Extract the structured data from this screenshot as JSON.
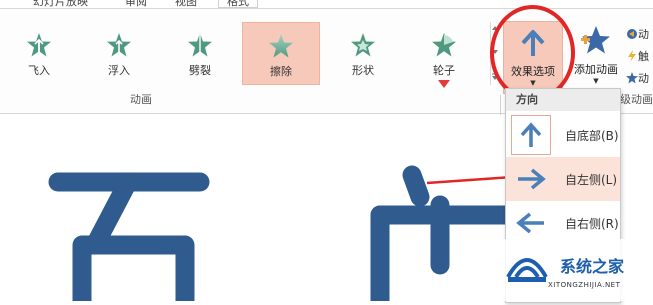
{
  "tabs": [
    {
      "label": "幻灯片放映"
    },
    {
      "label": "审阅"
    },
    {
      "label": "视图"
    },
    {
      "label": "格式"
    }
  ],
  "animations": [
    {
      "label": "飞入",
      "icon": "star-fly-in-icon"
    },
    {
      "label": "浮入",
      "icon": "star-float-in-icon"
    },
    {
      "label": "劈裂",
      "icon": "star-split-icon"
    },
    {
      "label": "擦除",
      "icon": "star-wipe-icon",
      "selected": true
    },
    {
      "label": "形状",
      "icon": "star-shape-icon"
    },
    {
      "label": "轮子",
      "icon": "star-wheel-icon"
    }
  ],
  "group_label": "动画",
  "effect_options": {
    "label": "效果选项",
    "icon": "up-arrow-icon"
  },
  "add_animation": {
    "label": "添加动画"
  },
  "right_group_label": "级动画",
  "side_items": [
    {
      "label": "动"
    },
    {
      "label": "触"
    },
    {
      "label": "动"
    }
  ],
  "dropdown": {
    "header": "方向",
    "items": [
      {
        "label": "自底部(B)",
        "icon": "arrow-up-icon"
      },
      {
        "label": "自左侧(L)",
        "icon": "arrow-right-icon"
      },
      {
        "label": "自右侧(R)",
        "icon": "arrow-left-icon"
      }
    ]
  },
  "slide_text": "百度",
  "watermark": {
    "title": "系统之家",
    "subtitle": "XITONGZHIJIA.NET"
  },
  "colors": {
    "accent": "#f6c9ba",
    "arrow_blue": "#4a7fb8",
    "star_green": "#4f9a7f",
    "annotation_red": "#e22525",
    "slide_text": "#2f5b8e"
  }
}
